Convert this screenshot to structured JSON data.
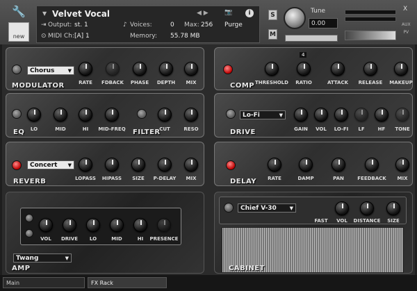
{
  "header": {
    "instrument_name": "Velvet Vocal",
    "output_label": "Output:",
    "output_value": "st. 1",
    "voices_label": "Voices:",
    "voices_value": "0",
    "max_label": "Max:",
    "max_value": "256",
    "purge_label": "Purge",
    "midi_label": "MIDI Ch:",
    "midi_value": "[A] 1",
    "memory_label": "Memory:",
    "memory_value": "55.78 MB",
    "solo": "S",
    "mute": "M",
    "tune_label": "Tune",
    "tune_value": "0.00",
    "new_label": "new",
    "aux": "AUX",
    "pv": "PV",
    "close": "X"
  },
  "modulator": {
    "name": "MODULATOR",
    "mode": "Chorus",
    "knobs": [
      "RATE",
      "FDBACK",
      "PHASE",
      "DEPTH",
      "MIX"
    ]
  },
  "comp": {
    "name": "COMP",
    "ratio_display": "4",
    "knobs": [
      "THRESHOLD",
      "RATIO",
      "ATTACK",
      "RELEASE",
      "MAKEUP"
    ]
  },
  "eq": {
    "name": "EQ",
    "knobs": [
      "LO",
      "MID",
      "HI",
      "MID-FREQ"
    ]
  },
  "filter": {
    "name": "FILTER",
    "knobs": [
      "CUT",
      "RESO"
    ]
  },
  "drive": {
    "name": "DRIVE",
    "mode": "Lo-Fi",
    "knobs": [
      "GAIN",
      "VOL",
      "LO-FI",
      "LF",
      "HF",
      "TONE"
    ]
  },
  "reverb": {
    "name": "REVERB",
    "mode": "Concert",
    "knobs": [
      "LOPASS",
      "HIPASS",
      "SIZE",
      "P-DELAY",
      "MIX"
    ]
  },
  "delay": {
    "name": "DELAY",
    "knobs": [
      "RATE",
      "DAMP",
      "PAN",
      "FEEDBACK",
      "MIX"
    ]
  },
  "amp": {
    "name": "AMP",
    "mode": "Twang",
    "knobs": [
      "VOL",
      "DRIVE",
      "LO",
      "MID",
      "HI",
      "PRESENCE"
    ]
  },
  "cabinet": {
    "name": "CABINET",
    "mode": "Chief V-30",
    "knobs": [
      "FAST",
      "VOL",
      "DISTANCE",
      "SIZE"
    ]
  },
  "status": {
    "tab_main": "Main",
    "tab_fx": "FX Rack"
  }
}
